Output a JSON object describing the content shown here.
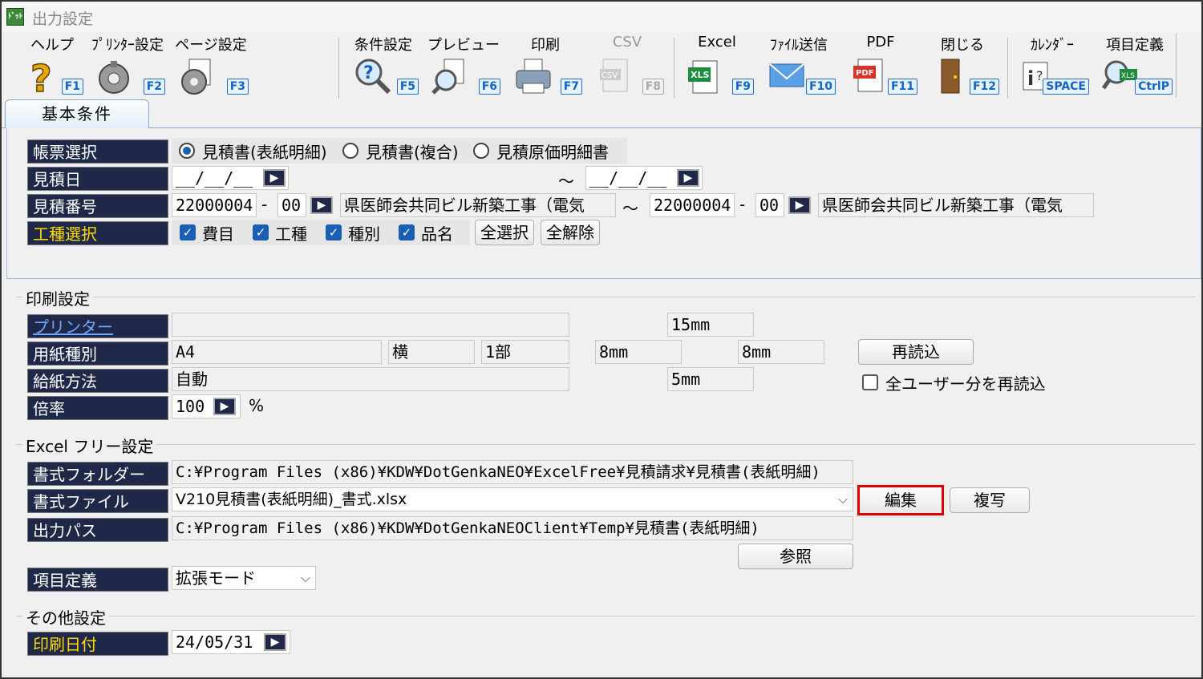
{
  "window": {
    "title": "出力設定",
    "icon": "app-icon"
  },
  "toolbar": [
    {
      "label": "ヘルプ",
      "key": "F1",
      "icon": "help-icon"
    },
    {
      "label": "ﾌﾟﾘﾝﾀｰ設定",
      "key": "F2",
      "icon": "printer-setup-icon"
    },
    {
      "label": "ページ設定",
      "key": "F3",
      "icon": "page-setup-icon"
    },
    {
      "label": "条件設定",
      "key": "F5",
      "icon": "condition-icon"
    },
    {
      "label": "プレビュー",
      "key": "F6",
      "icon": "preview-icon"
    },
    {
      "label": "印刷",
      "key": "F7",
      "icon": "print-icon"
    },
    {
      "label": "CSV",
      "key": "F8",
      "icon": "csv-icon",
      "disabled": true
    },
    {
      "label": "Excel",
      "key": "F9",
      "icon": "excel-icon"
    },
    {
      "label": "ﾌｧｲﾙ送信",
      "key": "F10",
      "icon": "mail-icon"
    },
    {
      "label": "PDF",
      "key": "F11",
      "icon": "pdf-icon"
    },
    {
      "label": "閉じる",
      "key": "F12",
      "icon": "door-icon"
    },
    {
      "label": "ｶﾚﾝﾀﾞｰ",
      "key": "SPACE",
      "icon": "calendar-icon"
    },
    {
      "label": "項目定義",
      "key": "CtrlP",
      "icon": "item-definition-icon"
    }
  ],
  "tabs": {
    "basic": "基本条件"
  },
  "basic": {
    "labels": {
      "report": "帳票選択",
      "date": "見積日",
      "number": "見積番号",
      "work": "工種選択"
    },
    "report_options": [
      "見積書(表紙明細)",
      "見積書(複合)",
      "見積原価明細書"
    ],
    "report_selected": 0,
    "date_from": "__/__/__",
    "date_to": "__/__/__",
    "tilde": "～",
    "num_from": "22000004",
    "num_from_sub": "00",
    "num_from_name": "県医師会共同ビル新築工事（電気",
    "num_to": "22000004",
    "num_to_sub": "00",
    "num_to_name": "県医師会共同ビル新築工事（電気",
    "dash": "-",
    "work_checks": [
      "費目",
      "工種",
      "種別",
      "品名"
    ],
    "select_all": "全選択",
    "clear_all": "全解除"
  },
  "print": {
    "section": "印刷設定",
    "labels": {
      "printer": "プリンター",
      "paper": "用紙種別",
      "feed": "給紙方法",
      "scale": "倍率"
    },
    "printer_value": "",
    "paper_size": "A4",
    "orientation": "横",
    "copies": "1部",
    "margin_top": "15mm",
    "margin_left": "8mm",
    "margin_right": "8mm",
    "margin_bottom": "5mm",
    "feed_value": "自動",
    "scale_value": "100",
    "scale_unit": "%",
    "reload": "再読込",
    "all_users_reload": "全ユーザー分を再読込"
  },
  "excel": {
    "section": "Excel フリー設定",
    "labels": {
      "folder": "書式フォルダー",
      "file": "書式ファイル",
      "output": "出力パス",
      "definition": "項目定義"
    },
    "folder_value": "C:¥Program Files (x86)¥KDW¥DotGenkaNEO¥ExcelFree¥見積請求¥見積書(表紙明細)",
    "file_value": "V210見積書(表紙明細)_書式.xlsx",
    "output_value": "C:¥Program Files (x86)¥KDW¥DotGenkaNEOClient¥Temp¥見積書(表紙明細)",
    "edit": "編集",
    "copy": "複写",
    "browse": "参照",
    "definition_value": "拡張モード",
    "highlight_color": "#e00000"
  },
  "other": {
    "section": "その他設定",
    "labels": {
      "print_date": "印刷日付"
    },
    "print_date_value": "24/05/31"
  }
}
